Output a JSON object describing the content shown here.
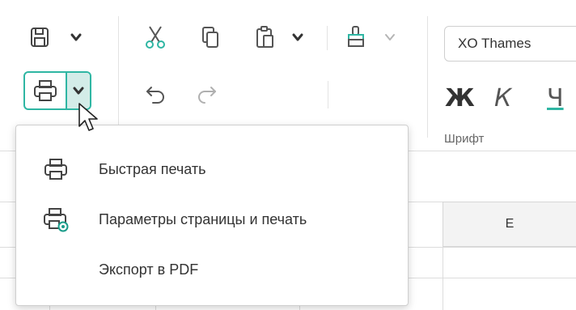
{
  "ribbon": {
    "font_name": "XO Thames",
    "bold_letter": "Ж",
    "italic_letter": "К",
    "underline_letter": "Ч",
    "font_group_label": "Шрифт"
  },
  "sheet": {
    "column_e_label": "E"
  },
  "print_menu": {
    "items": [
      {
        "label": "Быстрая печать",
        "icon": "printer-icon"
      },
      {
        "label": "Параметры страницы и печать",
        "icon": "printer-settings-icon"
      },
      {
        "label": "Экспорт в PDF",
        "icon": ""
      }
    ]
  },
  "colors": {
    "accent": "#2fb6a3",
    "accent_fill": "#d3ece8",
    "icon_green": "#1a9c8a"
  }
}
